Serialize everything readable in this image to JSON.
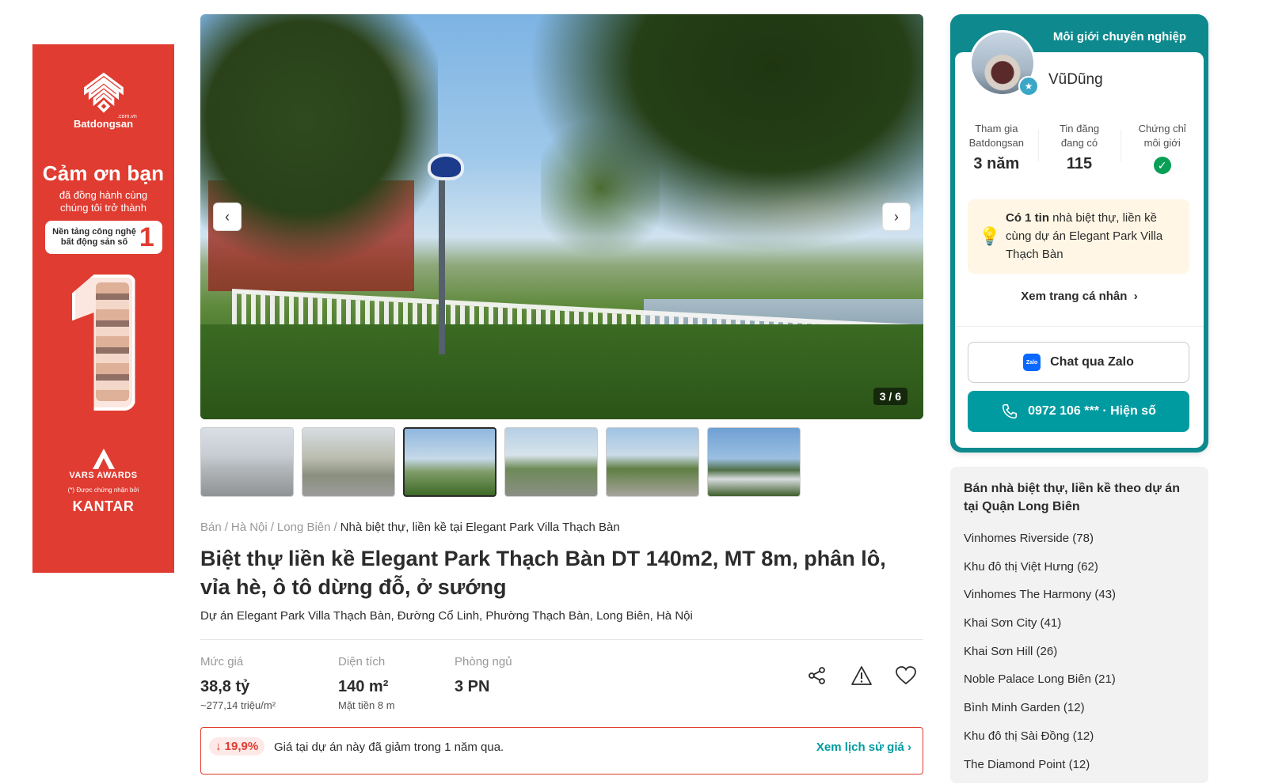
{
  "ad": {
    "brand": "Batdongsan",
    "brand_suffix": ".com.vn",
    "thanks": "Cảm ơn bạn",
    "sub1": "đã đồng hành cùng",
    "sub2": "chúng tôi trở thành",
    "pill1": "Nền tảng công nghệ",
    "pill2": "bất động sản số",
    "pill_number": "1",
    "awards": "VARS AWARDS",
    "recognized": "(*) Được chứng nhận bởi",
    "kantar": "KANTAR",
    "color": "#e03c31"
  },
  "gallery": {
    "counter": "3 / 6",
    "prev_icon": "chevron-left-icon",
    "next_icon": "chevron-right-icon",
    "thumbnail_count": 6,
    "active_thumbnail": 3
  },
  "breadcrumb": {
    "items": [
      "Bán",
      "Hà Nội",
      "Long Biên"
    ],
    "current": "Nhà biệt thự, liền kề tại Elegant Park Villa Thạch Bàn",
    "separator": "/"
  },
  "listing": {
    "title": "Biệt thự liền kề Elegant Park Thạch Bàn DT 140m2, MT 8m, phân lô, vỉa hè, ô tô dừng đỗ, ở sướng",
    "address": "Dự án Elegant Park Villa Thạch Bàn, Đường Cổ Linh, Phường Thạch Bàn, Long Biên, Hà Nội",
    "stats": {
      "price_label": "Mức giá",
      "price_value": "38,8 tỷ",
      "price_sub": "~277,14 triệu/m²",
      "area_label": "Diện tích",
      "area_value": "140 m²",
      "area_sub": "Mặt tiền 8 m",
      "bed_label": "Phòng ngủ",
      "bed_value": "3 PN"
    },
    "actions": [
      "share-icon",
      "report-icon",
      "heart-icon"
    ],
    "price_change": {
      "badge": "↓ 19,9%",
      "message": "Giá tại dự án này đã giảm trong 1 năm qua.",
      "history_link": "Xem lịch sử giá"
    }
  },
  "agent": {
    "badge_title": "Môi giới chuyên nghiệp",
    "name": "VũDũng",
    "stats": [
      {
        "label_line1": "Tham gia",
        "label_line2": "Batdongsan",
        "value": "3 năm"
      },
      {
        "label_line1": "Tin đăng",
        "label_line2": "đang có",
        "value": "115"
      },
      {
        "label_line1": "Chứng chỉ",
        "label_line2": "môi giới",
        "value": "check"
      }
    ],
    "note_bold": "Có 1 tin",
    "note_rest": " nhà biệt thự, liền kề cùng dự án Elegant Park Villa Thạch Bàn",
    "profile_link": "Xem trang cá nhân",
    "zalo_label": "Chat qua Zalo",
    "zalo_icon_text": "Zalo",
    "phone_label": "0972 106 *** · Hiện số",
    "accent": "#009ba1"
  },
  "projects": {
    "heading": "Bán nhà biệt thự, liền kề theo dự án tại Quận Long Biên",
    "items": [
      "Vinhomes Riverside (78)",
      "Khu đô thị Việt Hưng (62)",
      "Vinhomes The Harmony (43)",
      "Khai Sơn City (41)",
      "Khai Sơn Hill (26)",
      "Noble Palace Long Biên (21)",
      "Bình Minh Garden (12)",
      "Khu đô thị Sài Đồng (12)",
      "The Diamond Point (12)"
    ]
  }
}
